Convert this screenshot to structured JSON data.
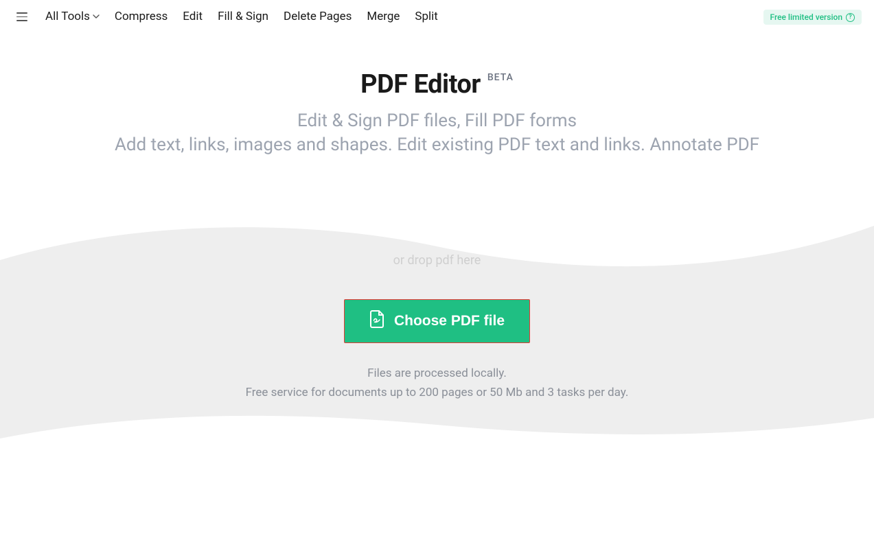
{
  "nav": {
    "all_tools": "All Tools",
    "compress": "Compress",
    "edit": "Edit",
    "fill_sign": "Fill & Sign",
    "delete_pages": "Delete Pages",
    "merge": "Merge",
    "split": "Split"
  },
  "version_badge": {
    "text": "Free limited version",
    "help": "?"
  },
  "hero": {
    "title": "PDF Editor",
    "beta": "BETA",
    "subtitle_line1": "Edit & Sign PDF files, Fill PDF forms",
    "subtitle_line2": "Add text, links, images and shapes. Edit existing PDF text and links. Annotate PDF"
  },
  "upload": {
    "drop_hint": "or drop pdf here",
    "button_label": "Choose PDF file",
    "info_line1": "Files are processed locally.",
    "info_line2": "Free service for documents up to 200 pages or 50 Mb and 3 tasks per day."
  }
}
